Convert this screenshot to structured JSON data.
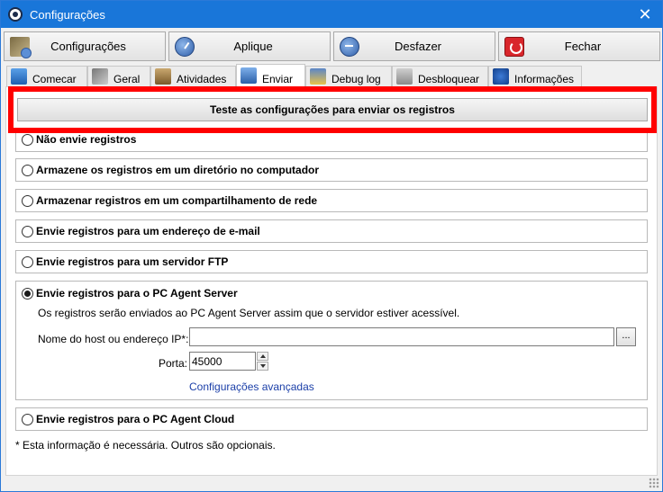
{
  "window": {
    "title": "Configurações",
    "close_glyph": "✕"
  },
  "toolbar": {
    "config_label": "Configurações",
    "apply_label": "Aplique",
    "undo_label": "Desfazer",
    "close_label": "Fechar"
  },
  "tabs": [
    {
      "label": "Comecar",
      "icon": "start-icon"
    },
    {
      "label": "Geral",
      "icon": "tools-icon"
    },
    {
      "label": "Atividades",
      "icon": "activities-icon"
    },
    {
      "label": "Enviar",
      "icon": "send-icon",
      "active": true
    },
    {
      "label": "Debug log",
      "icon": "debug-log-icon"
    },
    {
      "label": "Desbloquear",
      "icon": "unlock-icon"
    },
    {
      "label": "Informações",
      "icon": "info-icon"
    }
  ],
  "test_button": "Teste as configurações para enviar os registros",
  "options": {
    "none": "Não envie registros",
    "directory": "Armazene os registros em um diretório no computador",
    "network": "Armazenar registros em um compartilhamento de rede",
    "email": "Envie registros para um endereço de e-mail",
    "ftp": "Envie registros para um servidor FTP",
    "server": "Envie registros para o PC Agent Server",
    "cloud": "Envie registros para o PC Agent Cloud"
  },
  "server_group": {
    "description": "Os registros serão enviados ao PC Agent Server assim que o servidor estiver acessível.",
    "host_label": "Nome do host ou endereço IP*:",
    "host_value": "",
    "browse_label": "...",
    "port_label": "Porta:",
    "port_value": "45000",
    "advanced_link": "Configurações avançadas"
  },
  "footnote": "* Esta informação é necessária. Outros são opcionais.",
  "colors": {
    "titlebar": "#1976d9",
    "highlight": "#ff0000",
    "link": "#1b3fa8"
  }
}
